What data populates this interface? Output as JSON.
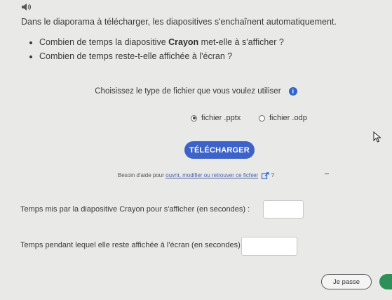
{
  "intro": "Dans le diaporama à télécharger, les diapositives s'enchaînent automatiquement.",
  "questions": {
    "q1_before": "Combien de temps la diapositive ",
    "q1_bold": "Crayon",
    "q1_after": " met-elle à s'afficher ?",
    "q2": "Combien de temps reste-t-elle affichée à l'écran ?"
  },
  "choose_label": "Choisissez le type de fichier que vous voulez utiliser",
  "file_options": [
    {
      "label": "fichier .pptx",
      "selected": true
    },
    {
      "label": "fichier .odp",
      "selected": false
    }
  ],
  "download_label": "TÉLÉCHARGER",
  "help": {
    "prefix": "Besoin d'aide pour ",
    "link": "ouvrir, modifier ou retrouver ce fichier",
    "suffix": " ?"
  },
  "fields": [
    {
      "label": "Temps mis par la diapositive Crayon pour s'afficher (en secondes) :",
      "value": ""
    },
    {
      "label": "Temps pendant lequel elle reste affichée à l'écran (en secondes) :",
      "value": ""
    }
  ],
  "pass_label": "Je passe",
  "colors": {
    "accent": "#3d63c9",
    "info": "#2f66c9",
    "green": "#2f8f58"
  }
}
